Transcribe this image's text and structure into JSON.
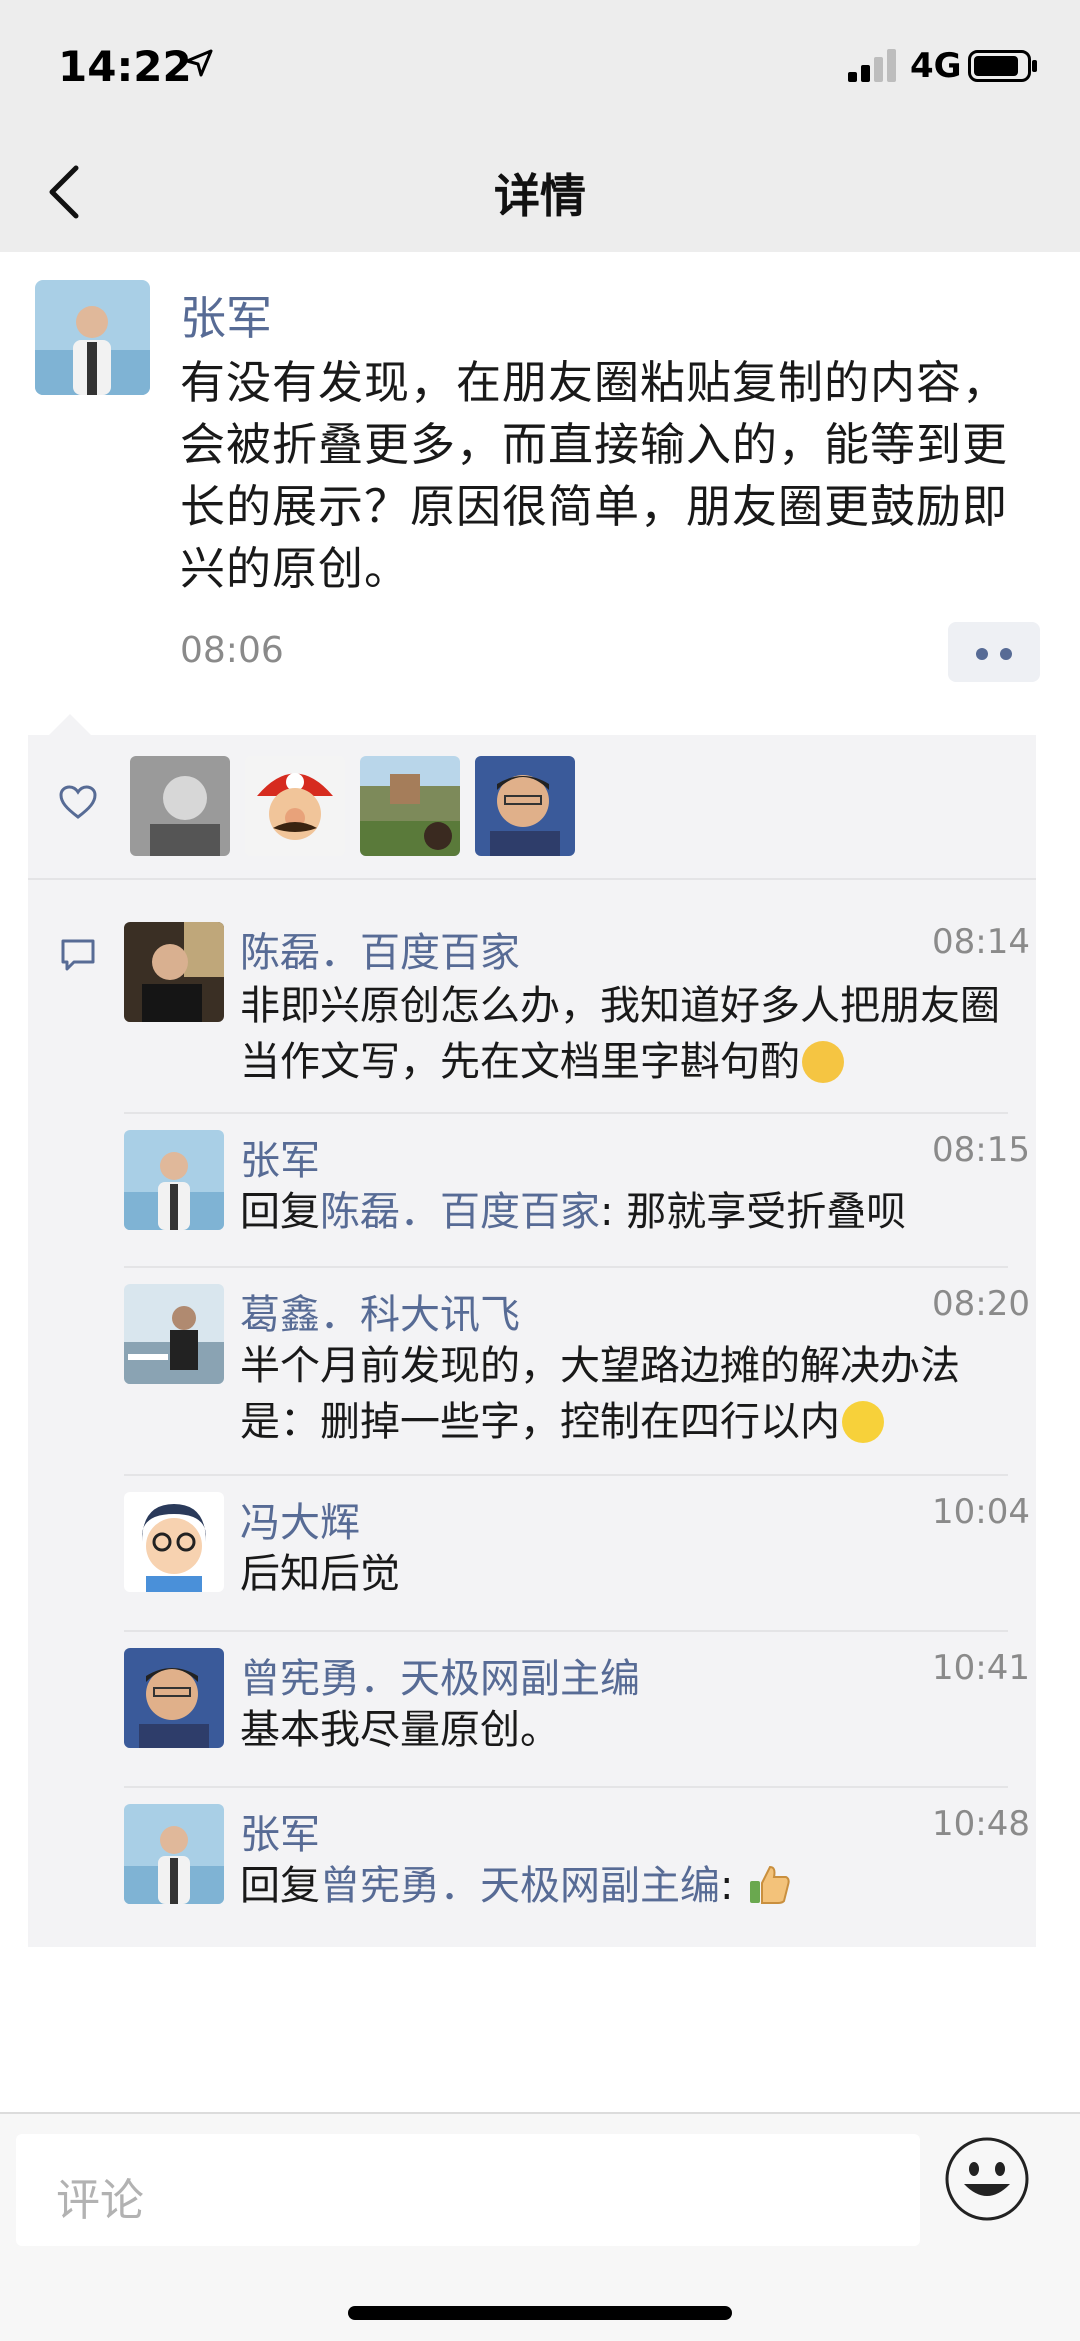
{
  "status": {
    "time": "14:22",
    "network": "4G"
  },
  "nav": {
    "title": "详情"
  },
  "post": {
    "author": "张军",
    "text": "有没有发现，在朋友圈粘贴复制的内容，会被折叠更多，而直接输入的，能等到更长的展示？原因很简单，朋友圈更鼓励即兴的原创。",
    "time": "08:06"
  },
  "likes": {
    "icon": "heart-icon",
    "count": 4
  },
  "comments": [
    {
      "name": "陈磊．百度百家",
      "time": "08:14",
      "text": "非即兴原创怎么办，我知道好多人把朋友圈当作文写，先在文档里字斟句酌"
    },
    {
      "name": "张军",
      "time": "08:15",
      "reply_prefix": "回复",
      "reply_to": "陈磊．百度百家",
      "text": ": 那就享受折叠呗"
    },
    {
      "name": "葛鑫．科大讯飞",
      "time": "08:20",
      "text": "半个月前发现的，大望路边摊的解决办法是：删掉一些字，控制在四行以内"
    },
    {
      "name": "冯大辉",
      "time": "10:04",
      "text": "后知后觉"
    },
    {
      "name": "曾宪勇．天极网副主编",
      "time": "10:41",
      "text": "基本我尽量原创。"
    },
    {
      "name": "张军",
      "time": "10:48",
      "reply_prefix": "回复",
      "reply_to": "曾宪勇．天极网副主编",
      "text": ":"
    }
  ],
  "input": {
    "placeholder": "评论"
  },
  "colors": {
    "link": "#576b95",
    "panel": "#f3f3f5",
    "bar": "#ededed"
  }
}
